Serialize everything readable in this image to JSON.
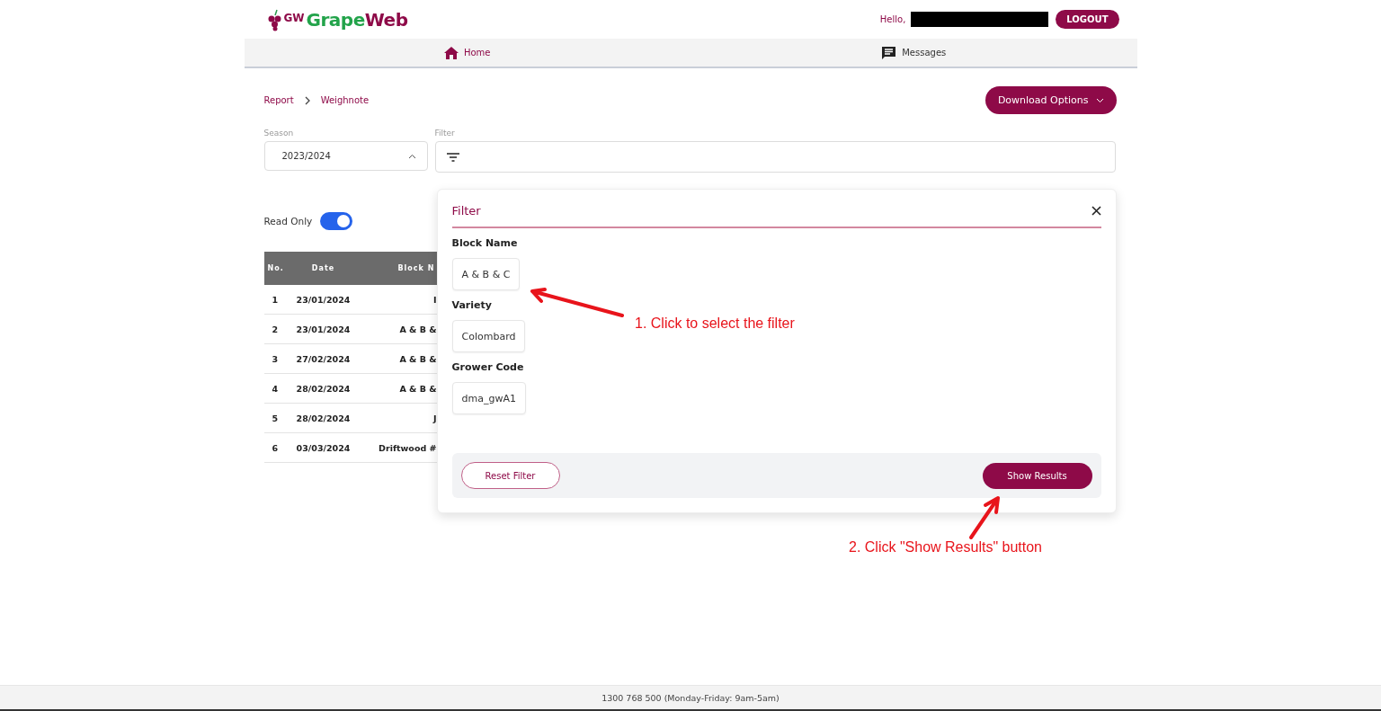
{
  "logo": {
    "monogram": "GW",
    "first": "Grape",
    "second": "Web"
  },
  "user": {
    "greeting": "Hello,",
    "logout": "LOGOUT"
  },
  "nav": [
    {
      "label": "Home"
    },
    {
      "label": "Messages"
    }
  ],
  "breadcrumb": [
    "Report",
    "Weighnote"
  ],
  "download_button": "Download Options",
  "season": {
    "label": "Season",
    "value": "2023/2024",
    "expanded": true
  },
  "filter_field": {
    "label": "Filter"
  },
  "read_only": {
    "label": "Read Only",
    "on": true
  },
  "table": {
    "columns": [
      "No.",
      "Date",
      "Block N"
    ],
    "rows": [
      [
        "1",
        "23/01/2024",
        "I"
      ],
      [
        "2",
        "23/01/2024",
        "A & B &"
      ],
      [
        "3",
        "27/02/2024",
        "A & B &"
      ],
      [
        "4",
        "28/02/2024",
        "A & B &"
      ],
      [
        "5",
        "28/02/2024",
        "J"
      ],
      [
        "6",
        "03/03/2024",
        "Driftwood #"
      ]
    ]
  },
  "filter_panel": {
    "title": "Filter",
    "groups": [
      {
        "label": "Block Name",
        "chips": [
          "A & B & C"
        ]
      },
      {
        "label": "Variety",
        "chips": [
          "Colombard"
        ]
      },
      {
        "label": "Grower Code",
        "chips": [
          "dma_gwA1"
        ]
      }
    ],
    "reset": "Reset Filter",
    "show": "Show Results"
  },
  "annotations": [
    "1. Click to select the filter",
    "2. Click \"Show Results\" button"
  ],
  "footer": "1300 768 500 (Monday-Friday: 9am-5am)"
}
